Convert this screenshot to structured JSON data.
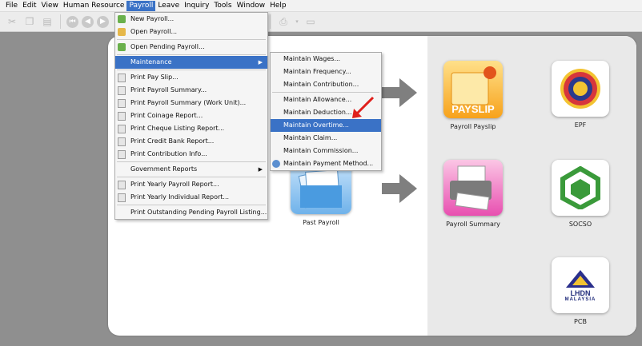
{
  "menubar": {
    "items": [
      "File",
      "Edit",
      "View",
      "Human Resource",
      "Payroll",
      "Leave",
      "Inquiry",
      "Tools",
      "Window",
      "Help"
    ],
    "active": "Payroll"
  },
  "payroll_menu": {
    "new_payroll": "New Payroll...",
    "open_payroll": "Open Payroll...",
    "open_pending": "Open Pending Payroll...",
    "maintenance": "Maintenance",
    "print_pay_slip": "Print Pay Slip...",
    "print_summary": "Print Payroll Summary...",
    "print_summary_work_unit": "Print Payroll Summary (Work Unit)...",
    "print_coinage": "Print Coinage Report...",
    "print_cheque": "Print Cheque Listing Report...",
    "print_credit_bank": "Print Credit Bank Report...",
    "print_contribution": "Print Contribution Info...",
    "government_reports": "Government Reports",
    "print_yearly_payroll": "Print Yearly Payroll Report...",
    "print_yearly_individual": "Print Yearly Individual Report...",
    "print_outstanding": "Print Outstanding Pending Payroll Listing..."
  },
  "maintenance_menu": {
    "wages": "Maintain Wages...",
    "frequency": "Maintain Frequency...",
    "contribution": "Maintain Contribution...",
    "allowance": "Maintain Allowance...",
    "deduction": "Maintain Deduction...",
    "overtime": "Maintain Overtime...",
    "claim": "Maintain Claim...",
    "commission": "Maintain Commission...",
    "payment_method": "Maintain Payment Method..."
  },
  "tiles": {
    "payslip_caption": "PAYSLIP",
    "payroll_payslip": "Payroll Payslip",
    "epf": "EPF",
    "past_payroll": "Past Payroll",
    "payroll_summary": "Payroll Summary",
    "socso": "SOCSO",
    "pcb": "PCB",
    "lhdn_line1": "LHDN",
    "lhdn_line2": "MALAYSIA"
  },
  "colors": {
    "menu_highlight": "#3a72c6",
    "payslip_orange": "#f7a21b",
    "summary_pink": "#e84fb0",
    "past_blue": "#3f8fd6",
    "socso_green": "#3a9a3a"
  }
}
